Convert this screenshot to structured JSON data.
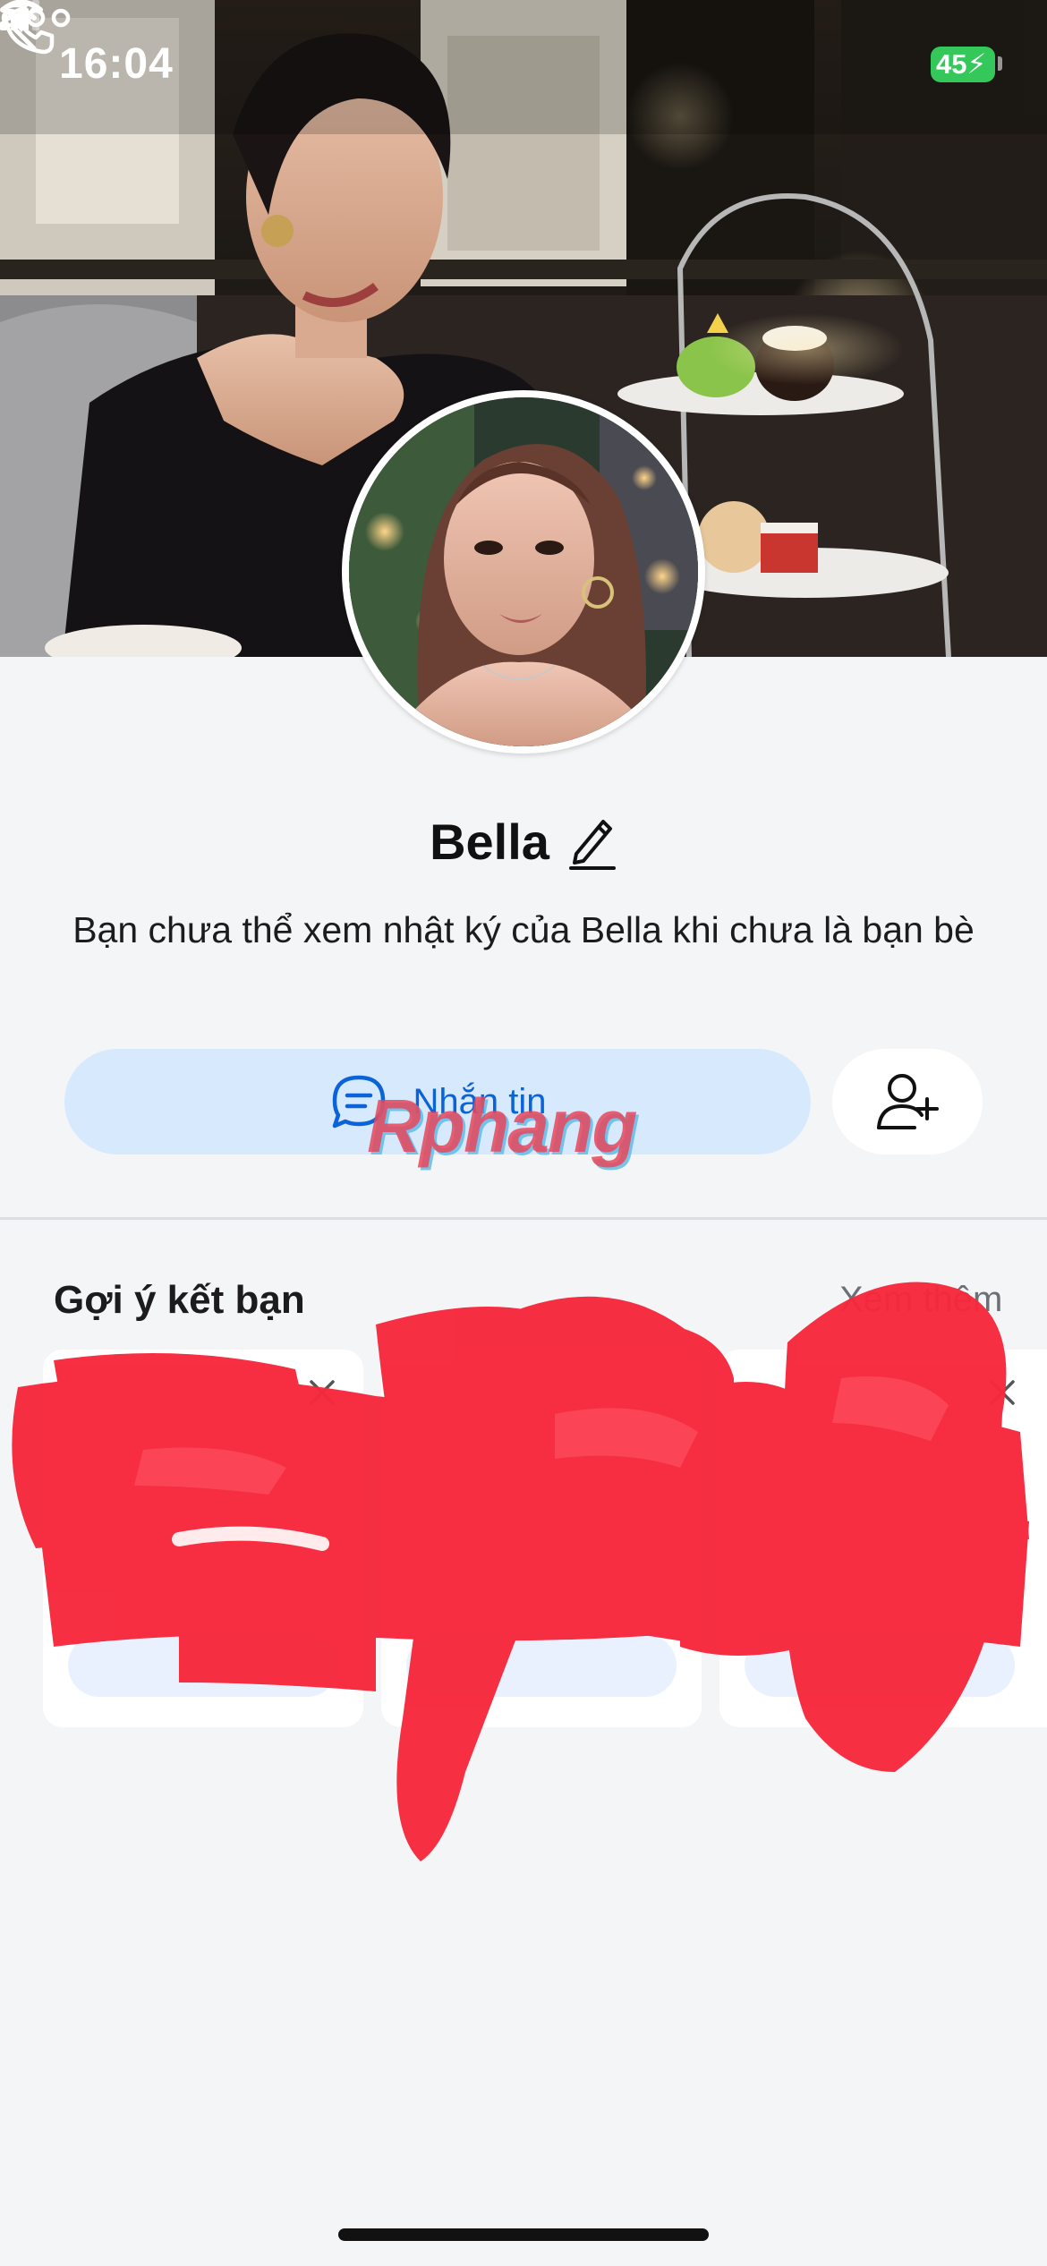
{
  "status_bar": {
    "time": "16:04",
    "battery": "45"
  },
  "nav": {
    "back_icon": "chevron-left-icon",
    "call_icon": "phone-icon",
    "more_icon": "more-horizontal-icon"
  },
  "profile": {
    "name": "Bella",
    "notice": "Bạn chưa thể xem nhật ký của Bella khi chưa là bạn bè"
  },
  "actions": {
    "message_label": "Nhắn tin",
    "add_friend_icon": "add-user-icon"
  },
  "watermark": "Rphang",
  "suggestions": {
    "title": "Gợi ý kết bạn",
    "more_label": "Xem thêm"
  },
  "colors": {
    "accent": "#0a63d8",
    "message_button_bg": "#d7e9fd",
    "page_bg": "#f4f5f7",
    "battery": "#34c759",
    "scribble": "#f7283c"
  }
}
